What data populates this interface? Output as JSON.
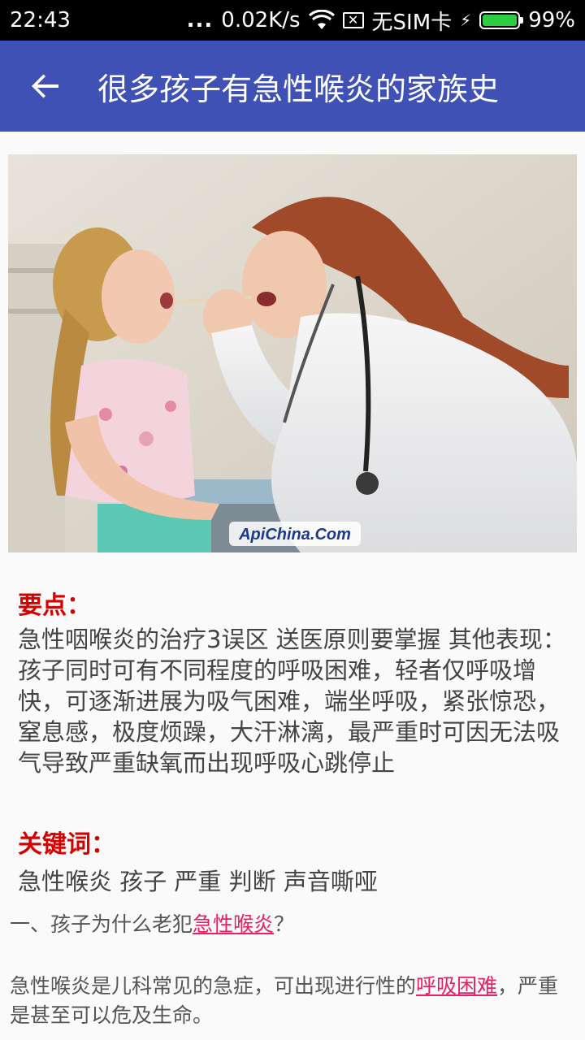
{
  "status_bar": {
    "time": "22:43",
    "dots": "...",
    "speed": "0.02K/s",
    "sim": "无SIM卡",
    "battery": "99%",
    "battery_level": 0.99,
    "icons": [
      "wifi-icon",
      "no-sim-icon",
      "charging-bolt-icon",
      "battery-icon"
    ]
  },
  "toolbar": {
    "back_icon": "arrow-left-icon",
    "title": "很多孩子有急性喉炎的家族史",
    "color": "#3f51b5"
  },
  "hero": {
    "watermark": "ApiChina.Com"
  },
  "summary": {
    "label": "要点：",
    "text": "急性咽喉炎的治疗3误区 送医原则要掌握 其他表现：孩子同时可有不同程度的呼吸困难，轻者仅呼吸增快，可逐渐进展为吸气困难，端坐呼吸，紧张惊恐，窒息感，极度烦躁，大汗淋漓，最严重时可因无法吸气导致严重缺氧而出现呼吸心跳停止"
  },
  "keywords": {
    "label": "关键词：",
    "text": "急性喉炎 孩子 严重 判断 声音嘶哑"
  },
  "article": {
    "q1_prefix": "一、孩子为什么老犯",
    "q1_link": "急性喉炎",
    "q1_suffix": "？",
    "p1_prefix": "急性喉炎是儿科常见的急症，可出现进行性的",
    "p1_link": "呼吸困难",
    "p1_suffix": "，严重是甚至可以危及生命。"
  },
  "colors": {
    "accent_red": "#d50000",
    "link_pink": "#e91e63"
  }
}
